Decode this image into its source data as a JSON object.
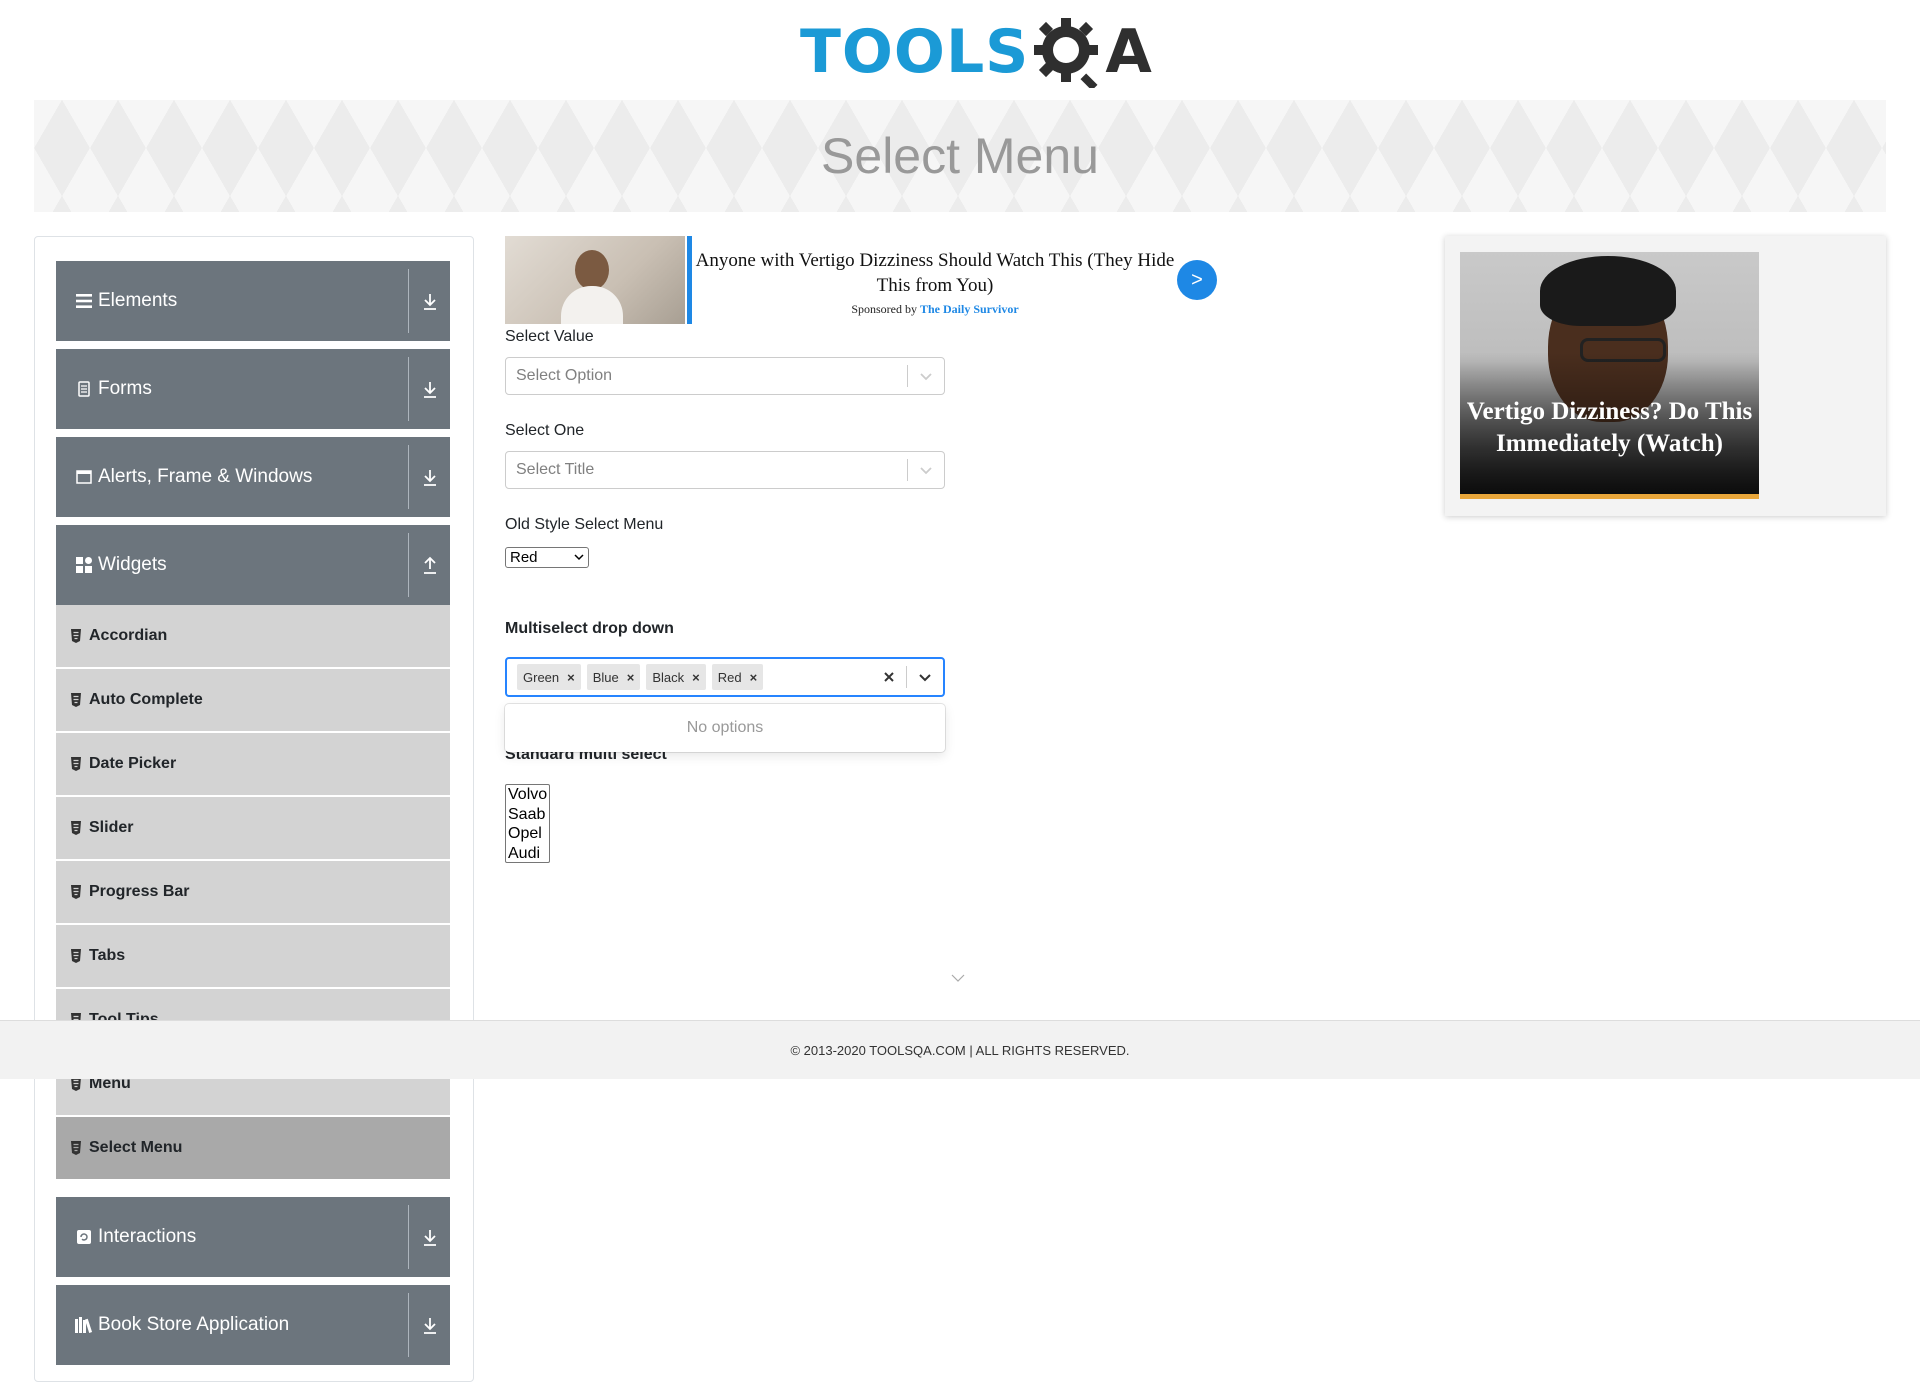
{
  "header": {
    "logo_left": "TOOLS",
    "logo_right": "A",
    "banner_title": "Select Menu"
  },
  "sidebar": {
    "groups": [
      {
        "label": "Elements",
        "icon": "list-icon",
        "arrow": "download-icon"
      },
      {
        "label": "Forms",
        "icon": "form-icon",
        "arrow": "download-icon"
      },
      {
        "label": "Alerts, Frame & Windows",
        "icon": "window-icon",
        "arrow": "download-icon"
      },
      {
        "label": "Widgets",
        "icon": "widgets-icon",
        "arrow": "upload-icon"
      },
      {
        "label": "Interactions",
        "icon": "interaction-icon",
        "arrow": "download-icon"
      },
      {
        "label": "Book Store Application",
        "icon": "books-icon",
        "arrow": "download-icon"
      }
    ],
    "widget_items": [
      {
        "label": "Accordian"
      },
      {
        "label": "Auto Complete"
      },
      {
        "label": "Date Picker"
      },
      {
        "label": "Slider"
      },
      {
        "label": "Progress Bar"
      },
      {
        "label": "Tabs"
      },
      {
        "label": "Tool Tips"
      },
      {
        "label": "Menu"
      },
      {
        "label": "Select Menu",
        "active": true
      }
    ]
  },
  "ad_top": {
    "headline": "Anyone with Vertigo Dizziness Should Watch This (They Hide This from You)",
    "sponsor_prefix": "Sponsored by",
    "sponsor_name": "The Daily Survivor",
    "button": ">"
  },
  "form": {
    "select_value": {
      "label": "Select Value",
      "placeholder": "Select Option"
    },
    "select_one": {
      "label": "Select One",
      "placeholder": "Select Title"
    },
    "old_style": {
      "label": "Old Style Select Menu",
      "value": "Red"
    },
    "multiselect": {
      "label": "Multiselect drop down",
      "chips": [
        "Green",
        "Blue",
        "Black",
        "Red"
      ],
      "menu_message": "No options"
    },
    "standard_multi": {
      "label": "Standard multi select",
      "options": [
        "Volvo",
        "Saab",
        "Opel",
        "Audi"
      ]
    }
  },
  "ad_right": {
    "headline": "Vertigo Dizziness? Do This Immediately (Watch)"
  },
  "footer": {
    "copyright": "© 2013-2020 TOOLSQA.COM | ALL RIGHTS RESERVED."
  },
  "colors": {
    "sidebar_group": "#6c757d",
    "sidebar_item": "#d3d3d3",
    "sidebar_item_active": "#a9a9a9",
    "focus_border": "#2684ff",
    "logo_blue": "#1b9ad6",
    "ad_blue": "#1e88e5"
  }
}
